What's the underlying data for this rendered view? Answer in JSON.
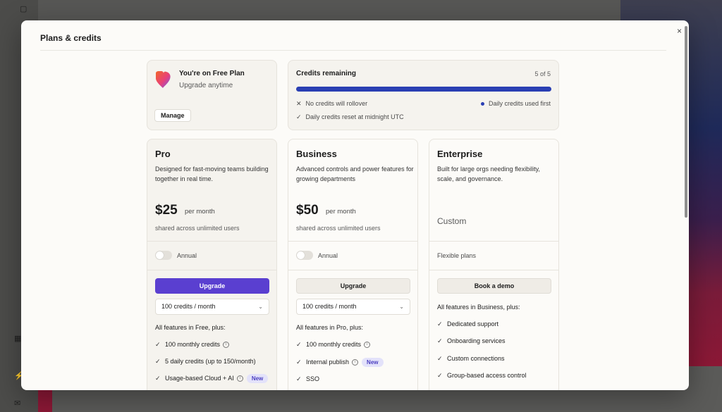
{
  "modal": {
    "title": "Plans & credits",
    "close_icon": "close-icon"
  },
  "plan": {
    "name": "You're on Free Plan",
    "subtitle": "Upgrade anytime",
    "manage_label": "Manage",
    "logo_icon": "heart-logo-icon"
  },
  "credits": {
    "title": "Credits remaining",
    "count": "5 of 5",
    "progress_fraction": 1.0,
    "bar_color": "#2a3fb3",
    "rollover": "No credits will rollover",
    "used_first": "Daily credits used first",
    "reset": "Daily credits reset at midnight UTC"
  },
  "tiers": {
    "pro": {
      "name": "Pro",
      "description": "Designed for fast-moving teams building together in real time.",
      "price": "$25",
      "period": "per month",
      "shared": "shared across unlimited users",
      "annual_label": "Annual",
      "cta": "Upgrade",
      "credits_select": "100 credits / month",
      "features_heading": "All features in Free, plus:",
      "features": [
        "100 monthly credits",
        "5 daily credits (up to 150/month)",
        "Usage-based Cloud + AI"
      ],
      "badge": "New"
    },
    "business": {
      "name": "Business",
      "description": "Advanced controls and power features for growing departments",
      "price": "$50",
      "period": "per month",
      "shared": "shared across unlimited users",
      "annual_label": "Annual",
      "cta": "Upgrade",
      "credits_select": "100 credits / month",
      "features_heading": "All features in Pro, plus:",
      "features": [
        "100 monthly credits",
        "Internal publish",
        "SSO"
      ],
      "badge": "New"
    },
    "enterprise": {
      "name": "Enterprise",
      "description": "Built for large orgs needing flexibility, scale, and governance.",
      "price": "Custom",
      "flexible": "Flexible plans",
      "cta": "Book a demo",
      "features_heading": "All features in Business, plus:",
      "features": [
        "Dedicated support",
        "Onboarding services",
        "Custom connections",
        "Group-based access control"
      ]
    }
  },
  "colors": {
    "accent": "#5a3fd0",
    "badge_bg": "#e3e2fa",
    "badge_text": "#4b3fc0"
  }
}
